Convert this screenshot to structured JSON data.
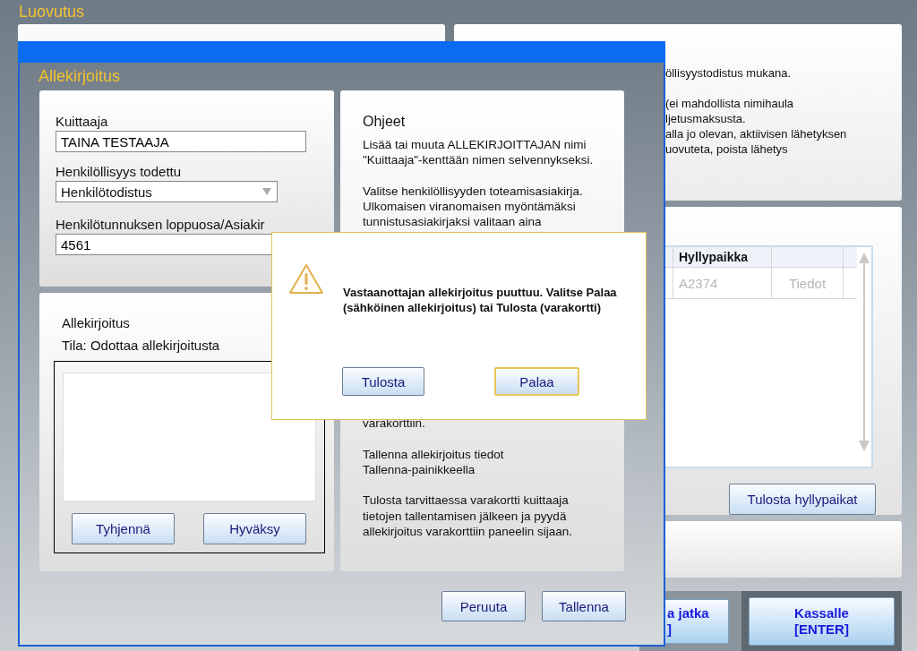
{
  "page": {
    "title": "Luovutus"
  },
  "info_panel": {
    "paragraphs": [
      [
        "öllisyystodistus mukana."
      ],
      [
        "(ei mahdollista nimihaula",
        "ljetusmaksusta.",
        "alla jo olevan, aktiivisen lähetyksen",
        "uovuteta, poista lähetys"
      ]
    ]
  },
  "table": {
    "columns": [
      "",
      "Hyllypaikka",
      ""
    ],
    "rows": [
      {
        "cells": [
          "",
          "A2374",
          "Tiedot"
        ],
        "disabled": true
      }
    ]
  },
  "print_button": "Tulosta hyllypaikat",
  "footer_buttons": [
    {
      "lines": [
        "a jatka",
        "]"
      ]
    },
    {
      "lines": [
        "Kassalle",
        "[ENTER]"
      ]
    }
  ],
  "dialog": {
    "title": "Allekirjoitus",
    "fields": [
      {
        "kind": "text",
        "label": "Kuittaaja",
        "value": "TAINA TESTAAJA"
      },
      {
        "kind": "select",
        "label": "Henkilöllisyys todettu",
        "value": "Henkilötodistus"
      },
      {
        "kind": "text",
        "label": "Henkilötunnuksen loppuosa/Asiakir",
        "value": "4561"
      }
    ],
    "signature": {
      "title": "Allekirjoitus",
      "status": "Tila: Odottaa allekirjoitusta",
      "buttons": [
        "Tyhjennä",
        "Hyväksy"
      ]
    },
    "help": {
      "title": "Ohjeet",
      "paragraphs": [
        {
          "lines": [
            "Lisää tai muuta ALLEKIRJOITTAJAN nimi",
            "\"Kuittaaja\"-kenttään nimen selvennykseksi."
          ]
        },
        {
          "lines": [
            "Valitse henkilöllisyyden toteamisasiakirja.",
            "Ulkomaisen viranomaisen myöntämäksi",
            "tunnistusasiakirjaksi valitaan aina"
          ]
        },
        {
          "lines": [
            "varakorttiin."
          ]
        },
        {
          "lines": [
            "Tallenna allekirjoitus tiedot",
            "Tallenna-painikkeella"
          ]
        },
        {
          "lines": [
            "Tulosta tarvittaessa varakortti kuittaaja",
            "tietojen tallentamisen jälkeen ja pyydä",
            "allekirjoitus varakorttiin paneelin sijaan."
          ]
        }
      ]
    },
    "buttons": [
      "Peruuta",
      "Tallenna"
    ]
  },
  "alert": {
    "message": "Vastaanottajan allekirjoitus puuttuu. Valitse Palaa (sähköinen allekirjoitus) tai Tulosta (varakortti)",
    "buttons": [
      {
        "label": "Tulosta",
        "focused": false
      },
      {
        "label": "Palaa",
        "focused": true
      }
    ]
  }
}
